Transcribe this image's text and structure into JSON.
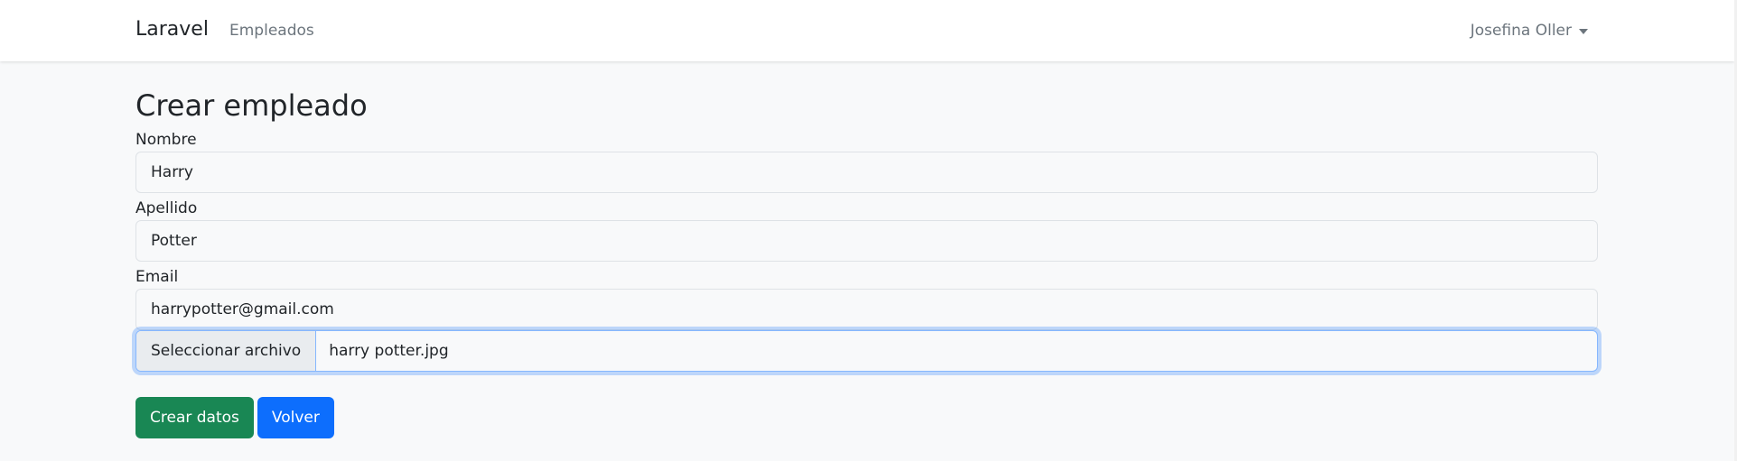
{
  "navbar": {
    "brand": "Laravel",
    "links": [
      {
        "label": "Empleados"
      }
    ],
    "user": {
      "name": "Josefina Oller"
    }
  },
  "form": {
    "title": "Crear empleado",
    "fields": {
      "nombre": {
        "label": "Nombre",
        "value": "Harry"
      },
      "apellido": {
        "label": "Apellido",
        "value": "Potter"
      },
      "email": {
        "label": "Email",
        "value": "harrypotter@gmail.com"
      }
    },
    "file": {
      "button_label": "Seleccionar archivo",
      "filename": "harry potter.jpg"
    },
    "buttons": {
      "submit": "Crear datos",
      "back": "Volver"
    }
  },
  "colors": {
    "navbar_bg": "#ffffff",
    "page_bg": "#f8f9fa",
    "submit_button": "#198754",
    "back_button": "#0d6efd",
    "focus_border": "#86b7fe"
  }
}
